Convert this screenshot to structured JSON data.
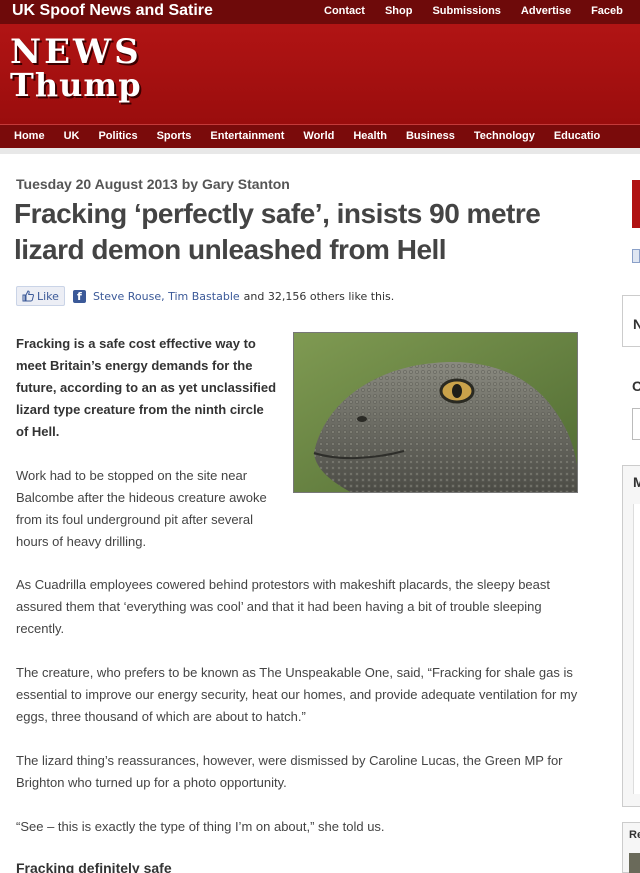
{
  "topbar": {
    "site_tag": "UK Spoof News and Satire",
    "links": [
      "Contact",
      "Shop",
      "Submissions",
      "Advertise",
      "Faceb"
    ]
  },
  "logo": {
    "line1": "NEWS",
    "line2": "Thump"
  },
  "nav": {
    "items": [
      "Home",
      "UK",
      "Politics",
      "Sports",
      "Entertainment",
      "World",
      "Health",
      "Business",
      "Technology",
      "Educatio"
    ]
  },
  "article": {
    "meta": "Tuesday 20 August 2013 by Gary Stanton",
    "headline": "Fracking ‘perfectly safe’, insists 90 metre lizard demon unleashed from Hell",
    "like_button": "Like",
    "like_names": "Steve Rouse, Tim Bastable",
    "like_rest": "and 32,156 others like this.",
    "lede": "Fracking is a safe cost effective way to meet Britain’s energy demands for the future, according to an as yet unclassified lizard type creature from the ninth circle of Hell.",
    "p1": "Work had to be stopped on the site near Balcombe after the hideous creature awoke from its foul underground pit after several hours of heavy drilling.",
    "p2": "As Cuadrilla employees cowered behind protestors with makeshift placards, the sleepy beast assured them that ‘everything was cool’ and that it had been having a bit of trouble sleeping recently.",
    "p3": "The creature, who prefers to be known as The Unspeakable One, said, “Fracking for shale gas is essential to improve our energy security, heat our homes, and provide adequate ventilation for my eggs, three thousand of which are about to hatch.”",
    "p4": "The lizard thing’s reassurances, however, were dismissed by Caroline Lucas, the Green MP for Brighton who turned up for a photo opportunity.",
    "p5": "“See – this is exactly the type of thing I’m on about,” she told us.",
    "subhead": "Fracking definitely safe"
  },
  "sidebar_fragments": {
    "n": "N",
    "c": "C",
    "m": "M",
    "r": "Re"
  },
  "colors": {
    "top_bar": "#6e0a0a",
    "banner": "#b11414",
    "nav": "#7a0b0b",
    "facebook": "#3b5998"
  }
}
